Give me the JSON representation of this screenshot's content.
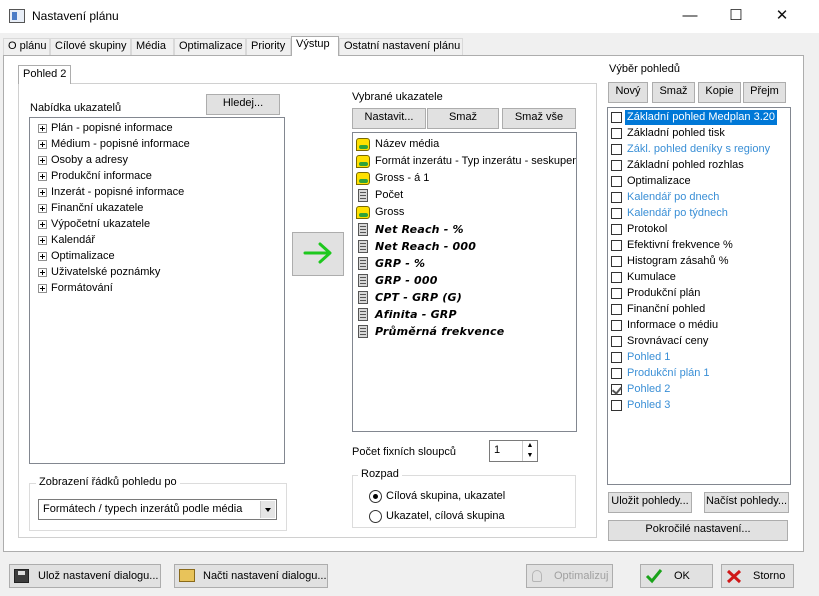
{
  "window": {
    "title": "Nastavení plánu"
  },
  "tabs": [
    "O plánu",
    "Cílové skupiny",
    "Média",
    "Optimalizace",
    "Priority",
    "Výstup",
    "Ostatní nastavení plánu"
  ],
  "active_tab": "Výstup",
  "subtab": "Pohled 2",
  "nabidka": {
    "label": "Nabídka ukazatelů",
    "search_button": "Hledej...",
    "items": [
      "Plán - popisné informace",
      "Médium - popisné informace",
      "Osoby a adresy",
      "Produkční informace",
      "Inzerát - popisné informace",
      "Finanční ukazatele",
      "Výpočetní ukazatele",
      "Kalendář",
      "Optimalizace",
      "Uživatelské poznámky",
      "Formátování"
    ]
  },
  "vybrane": {
    "label": "Vybrané ukazatele",
    "buttons": {
      "nastavit": "Nastavit...",
      "smaz": "Smaž",
      "smaz_vse": "Smaž vše"
    },
    "items": [
      {
        "label": "Název média",
        "icon": "data-icon"
      },
      {
        "label": "Formát inzerátu - Typ inzerátu - seskupený",
        "icon": "data-icon"
      },
      {
        "label": "Gross - á 1",
        "icon": "data-icon"
      },
      {
        "label": "Počet",
        "icon": "calculator-icon"
      },
      {
        "label": "Gross",
        "icon": "data-icon"
      },
      {
        "label": "Net Reach - %",
        "icon": "calculator-icon"
      },
      {
        "label": "Net Reach - 000",
        "icon": "calculator-icon"
      },
      {
        "label": "GRP - %",
        "icon": "calculator-icon"
      },
      {
        "label": "GRP - 000",
        "icon": "calculator-icon"
      },
      {
        "label": "CPT - GRP (G)",
        "icon": "calculator-icon"
      },
      {
        "label": "Afinita - GRP",
        "icon": "calculator-icon"
      },
      {
        "label": "Průměrná frekvence",
        "icon": "calculator-icon"
      }
    ]
  },
  "fixed_columns": {
    "label": "Počet fixních sloupců",
    "value": "1"
  },
  "rozpad": {
    "label": "Rozpad",
    "options": [
      "Cílová skupina, ukazatel",
      "Ukazatel, cílová skupina"
    ],
    "selected": 0
  },
  "zobrazeni": {
    "label": "Zobrazení řádků pohledu po",
    "value": "Formátech / typech inzerátů podle média"
  },
  "vyber": {
    "label": "Výběr pohledů",
    "buttons": {
      "novy": "Nový",
      "smaz": "Smaž",
      "kopie": "Kopie",
      "prejm": "Přejm"
    },
    "items": [
      {
        "label": "Základní pohled Medplan 3.20",
        "checked": false,
        "blue": false,
        "selected": true
      },
      {
        "label": "Základní pohled tisk",
        "checked": false,
        "blue": false
      },
      {
        "label": "Zákl. pohled deníky s regiony",
        "checked": false,
        "blue": true
      },
      {
        "label": "Základní pohled rozhlas",
        "checked": false,
        "blue": false
      },
      {
        "label": "Optimalizace",
        "checked": false,
        "blue": false
      },
      {
        "label": "Kalendář po dnech",
        "checked": false,
        "blue": true
      },
      {
        "label": "Kalendář po týdnech",
        "checked": false,
        "blue": true
      },
      {
        "label": "Protokol",
        "checked": false,
        "blue": false
      },
      {
        "label": "Efektivní frekvence %",
        "checked": false,
        "blue": false
      },
      {
        "label": "Histogram zásahů %",
        "checked": false,
        "blue": false
      },
      {
        "label": "Kumulace",
        "checked": false,
        "blue": false
      },
      {
        "label": "Produkční plán",
        "checked": false,
        "blue": false
      },
      {
        "label": "Finanční pohled",
        "checked": false,
        "blue": false
      },
      {
        "label": "Informace o médiu",
        "checked": false,
        "blue": false
      },
      {
        "label": "Srovnávací ceny",
        "checked": false,
        "blue": false
      },
      {
        "label": "Pohled 1",
        "checked": false,
        "blue": true
      },
      {
        "label": "Produkční plán 1",
        "checked": false,
        "blue": true
      },
      {
        "label": "Pohled 2",
        "checked": true,
        "blue": true
      },
      {
        "label": "Pohled 3",
        "checked": false,
        "blue": true
      }
    ],
    "save_button": "Uložit pohledy...",
    "load_button": "Načíst pohledy...",
    "advanced_button": "Pokročilé nastavení..."
  },
  "footer": {
    "save_settings": "Ulož nastavení dialogu...",
    "load_settings": "Načti nastavení dialogu...",
    "optimize": "Optimalizuj",
    "ok": "OK",
    "cancel": "Storno"
  }
}
